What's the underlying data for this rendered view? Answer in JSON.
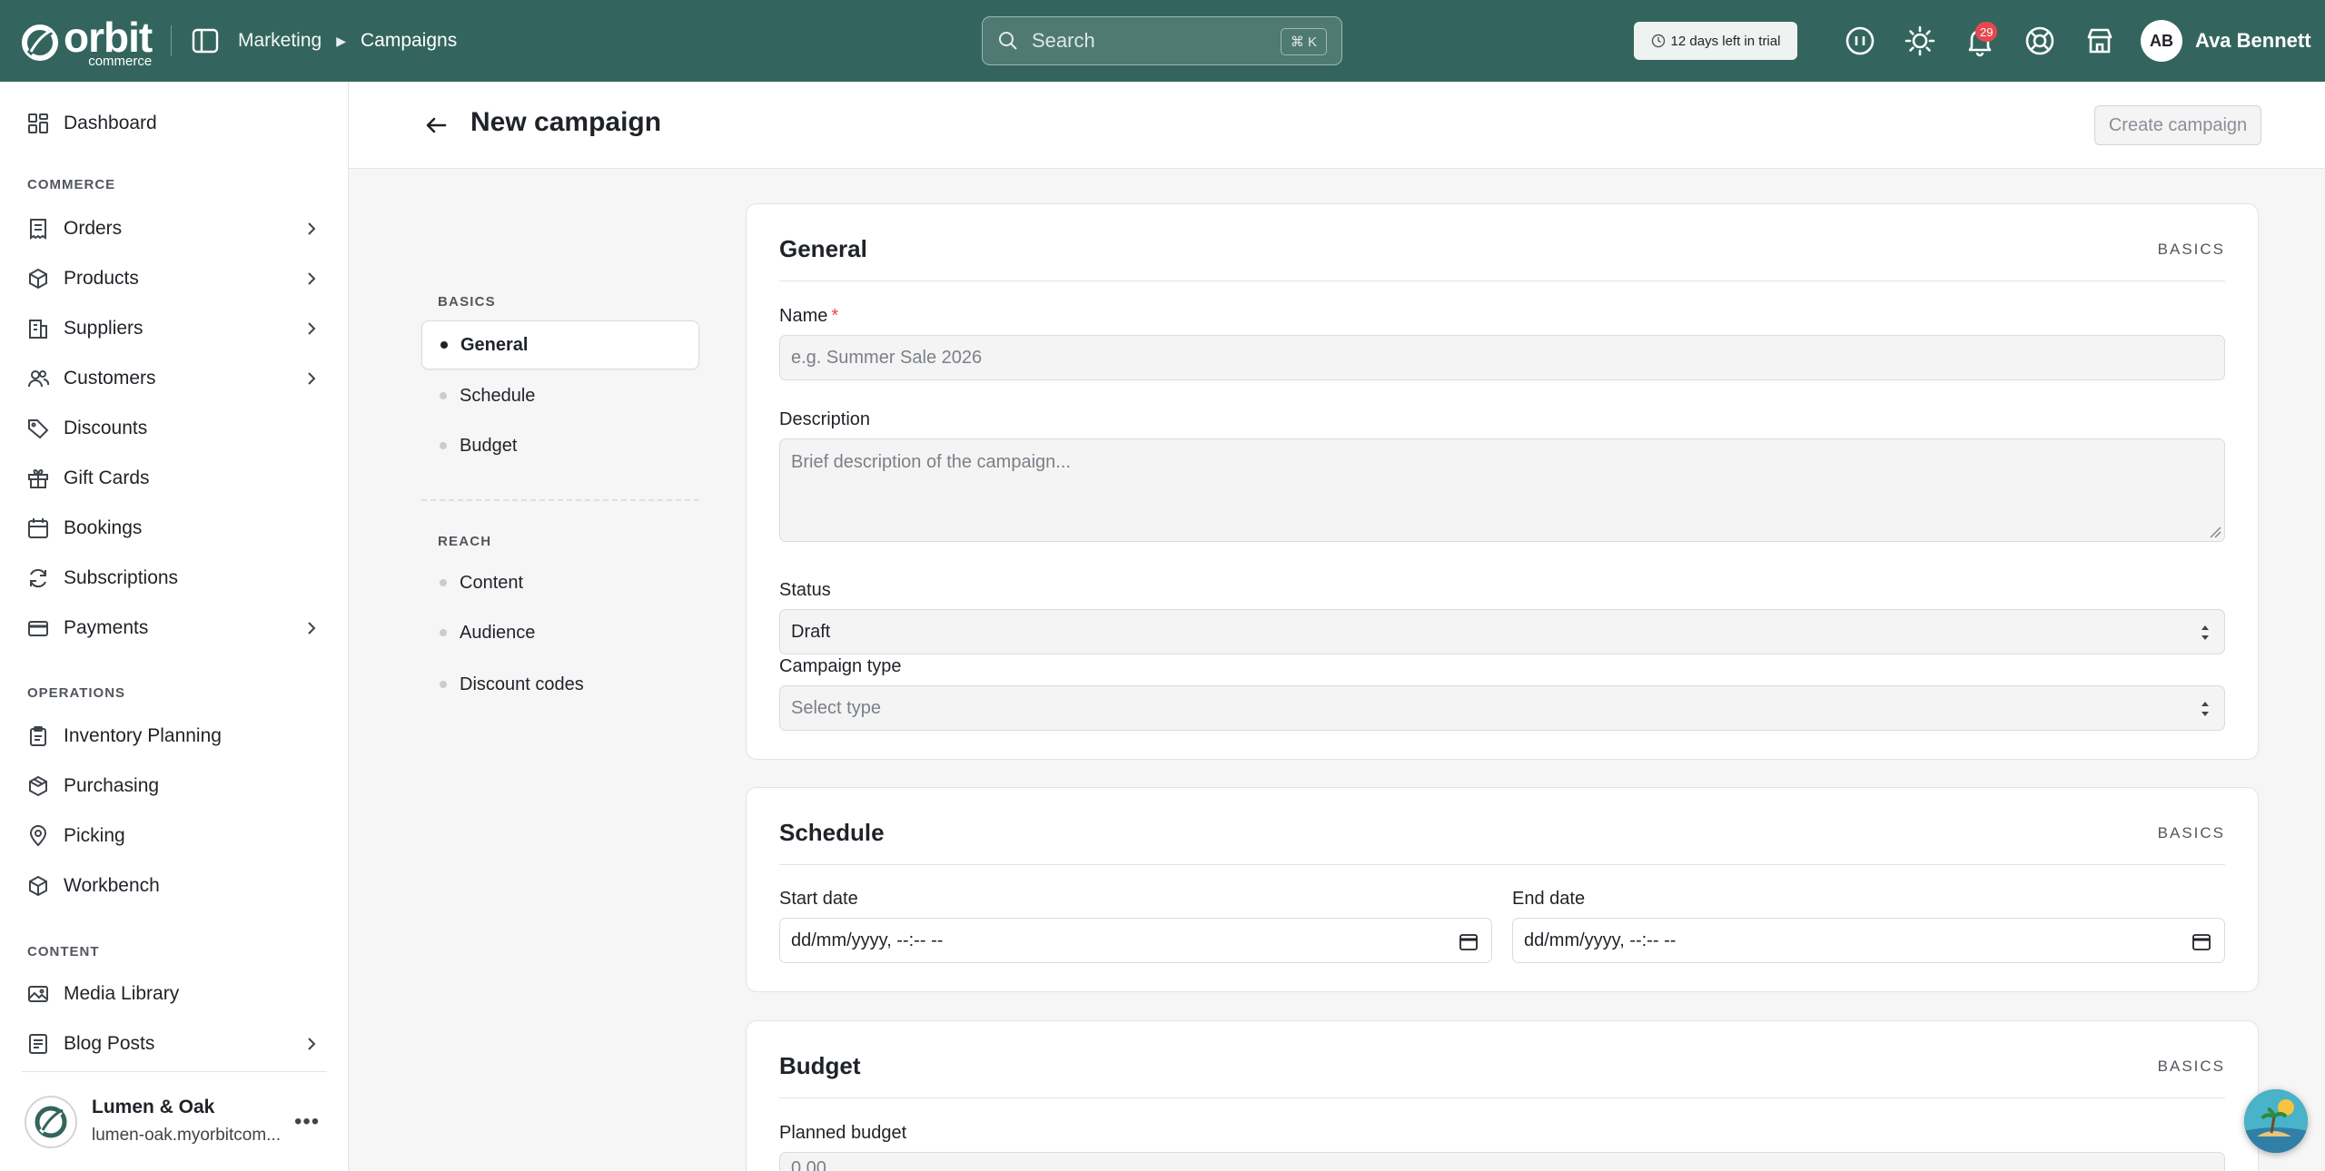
{
  "app": {
    "brand": "orbit",
    "brand_sub": "commerce"
  },
  "breadcrumb": [
    "Marketing",
    "Campaigns"
  ],
  "search": {
    "placeholder": "Search",
    "shortcut": "⌘ K"
  },
  "trial": {
    "label": "12 days left in trial"
  },
  "notifications": {
    "count": "29"
  },
  "user": {
    "initials": "AB",
    "name": "Ava Bennett"
  },
  "sidebar": {
    "dashboard": "Dashboard",
    "sections": {
      "commerce": "COMMERCE",
      "operations": "OPERATIONS",
      "content": "CONTENT"
    },
    "commerce_items": [
      {
        "label": "Orders"
      },
      {
        "label": "Products"
      },
      {
        "label": "Suppliers"
      },
      {
        "label": "Customers"
      },
      {
        "label": "Discounts"
      },
      {
        "label": "Gift Cards"
      },
      {
        "label": "Bookings"
      },
      {
        "label": "Subscriptions"
      },
      {
        "label": "Payments"
      }
    ],
    "operations_items": [
      {
        "label": "Inventory Planning"
      },
      {
        "label": "Purchasing"
      },
      {
        "label": "Picking"
      },
      {
        "label": "Workbench"
      }
    ],
    "content_items": [
      {
        "label": "Media Library"
      },
      {
        "label": "Blog Posts"
      }
    ],
    "store": {
      "name": "Lumen & Oak",
      "url": "lumen-oak.myorbitcom..."
    }
  },
  "page": {
    "title": "New campaign",
    "create_label": "Create campaign"
  },
  "section_nav": {
    "basics_heading": "BASICS",
    "reach_heading": "REACH",
    "basics": [
      {
        "label": "General"
      },
      {
        "label": "Schedule"
      },
      {
        "label": "Budget"
      }
    ],
    "reach": [
      {
        "label": "Content"
      },
      {
        "label": "Audience"
      },
      {
        "label": "Discount codes"
      }
    ]
  },
  "general": {
    "title": "General",
    "tag": "BASICS",
    "name_label": "Name",
    "name_required": "*",
    "name_placeholder": "e.g. Summer Sale 2026",
    "description_label": "Description",
    "description_placeholder": "Brief description of the campaign...",
    "status_label": "Status",
    "status_value": "Draft",
    "type_label": "Campaign type",
    "type_placeholder": "Select type"
  },
  "schedule": {
    "title": "Schedule",
    "tag": "BASICS",
    "start_label": "Start date",
    "start_value": "dd/mm/yyyy, --:-- --",
    "end_label": "End date",
    "end_value": "dd/mm/yyyy, --:-- --"
  },
  "budget": {
    "title": "Budget",
    "tag": "BASICS",
    "planned_label": "Planned budget",
    "planned_placeholder": "0.00"
  },
  "colors": {
    "topbar": "#33655e",
    "badge": "#e5484d"
  }
}
